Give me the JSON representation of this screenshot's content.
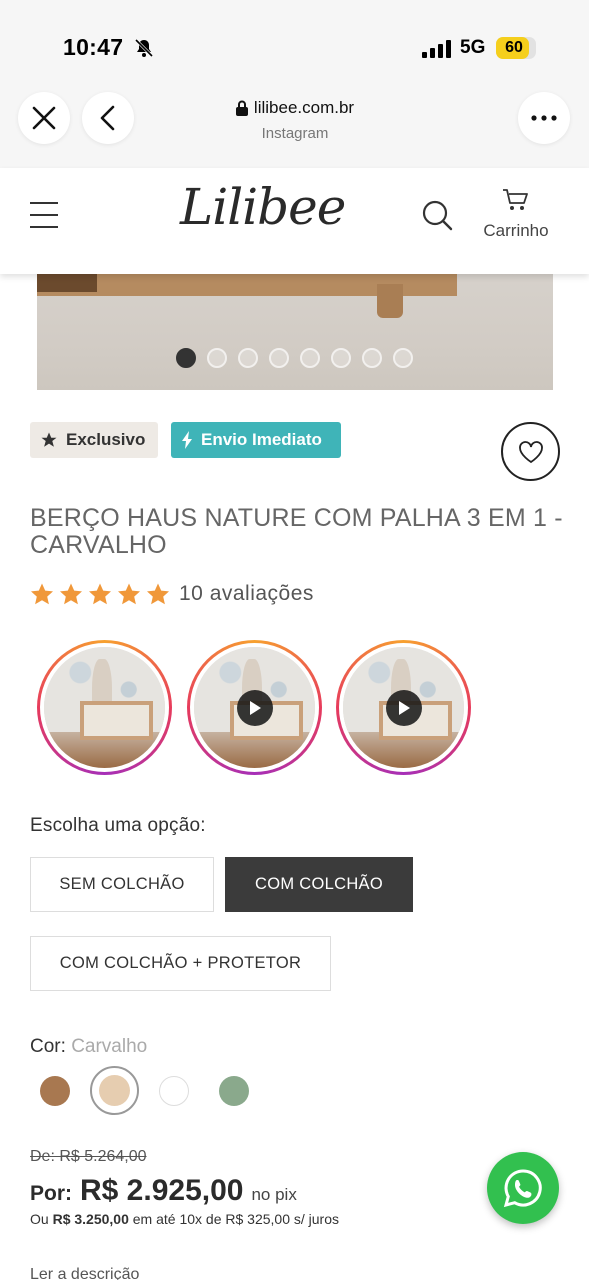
{
  "status_bar": {
    "time": "10:47",
    "network": "5G",
    "battery": "60"
  },
  "browser": {
    "url": "lilibee.com.br",
    "source": "Instagram"
  },
  "header": {
    "logo": "Lilibee",
    "cart_label": "Carrinho"
  },
  "gallery": {
    "dot_count": 8,
    "active_index": 0
  },
  "badges": {
    "exclusive": "Exclusivo",
    "shipping": "Envio Imediato"
  },
  "product": {
    "title": "BERÇO HAUS NATURE COM PALHA 3 EM 1 - CARVALHO",
    "rating_stars": 5,
    "reviews": "10 avaliações"
  },
  "options": {
    "label": "Escolha uma opção:",
    "items": [
      "SEM COLCHÃO",
      "COM COLCHÃO",
      "COM COLCHÃO + PROTETOR"
    ],
    "selected": "COM COLCHÃO"
  },
  "color": {
    "label": "Cor:",
    "value": "Carvalho",
    "swatches": [
      "#a87850",
      "#e6cdb0",
      "#ffffff",
      "#8aa98c"
    ]
  },
  "price": {
    "old": "De: R$ 5.264,00",
    "por_label": "Por:",
    "current": "R$ 2.925,00",
    "suffix": "no pix",
    "install_prefix": "Ou",
    "install_total": "R$ 3.250,00",
    "install_rest": "em até 10x de R$ 325,00 s/ juros"
  },
  "links": {
    "read_description": "Ler a descrição"
  },
  "colors": {
    "badge_teal": "#3fb4b8",
    "star": "#f0983a",
    "whatsapp": "#32c04f"
  }
}
